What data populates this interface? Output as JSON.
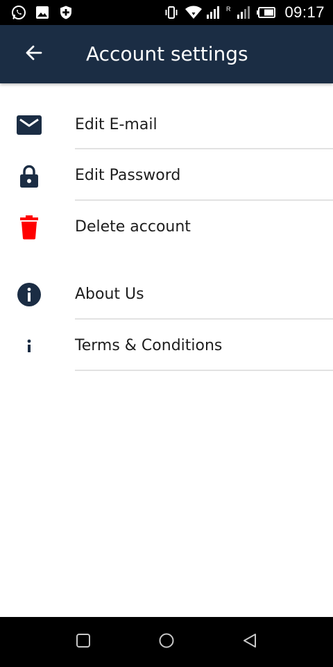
{
  "status_bar": {
    "time": "09:17",
    "left_icons": [
      "whatsapp-icon",
      "gallery-icon",
      "shield-plus-icon"
    ],
    "right_icons": [
      "vibrate-icon",
      "wifi-icon",
      "signal-icon",
      "roaming-signal-icon",
      "battery-icon"
    ],
    "roaming_label": "R"
  },
  "app_bar": {
    "title": "Account settings",
    "back_icon": "arrow-back-icon",
    "background": "#1b2d44"
  },
  "menu": {
    "items": [
      {
        "label": "Edit E-mail",
        "icon": "envelope-icon",
        "color": "#1b2d44"
      },
      {
        "label": "Edit Password",
        "icon": "lock-icon",
        "color": "#1b2d44"
      },
      {
        "label": "Delete account",
        "icon": "trash-icon",
        "color": "#ff0000"
      },
      {
        "label": "About Us",
        "icon": "info-circle-icon",
        "color": "#1b2d44"
      },
      {
        "label": "Terms & Conditions",
        "icon": "info-icon",
        "color": "#1b2d44"
      }
    ]
  },
  "nav_bar": {
    "buttons": [
      "recents-square-icon",
      "home-circle-icon",
      "back-triangle-icon"
    ]
  }
}
